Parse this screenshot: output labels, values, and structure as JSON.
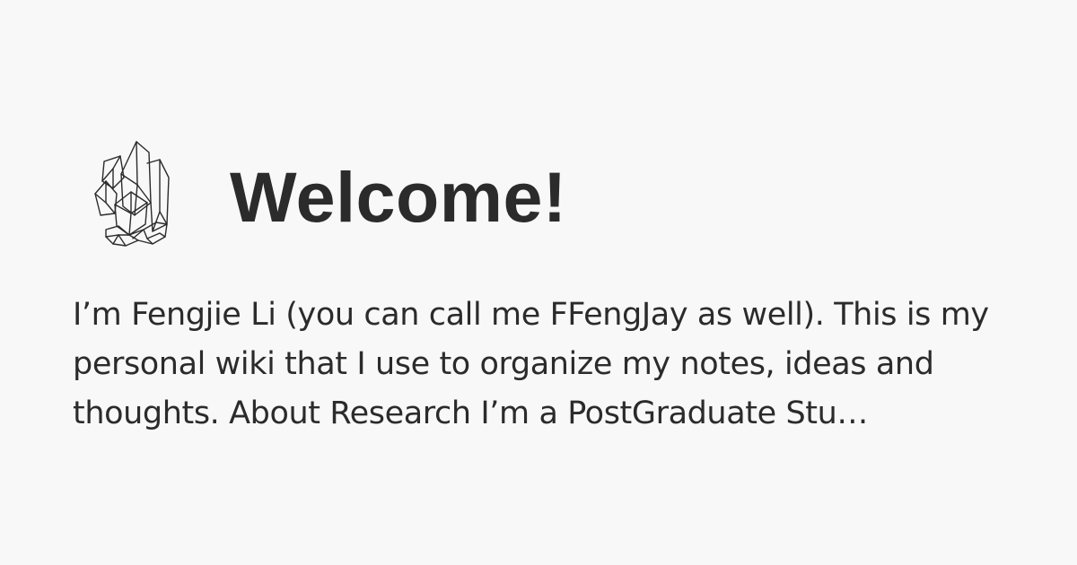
{
  "page": {
    "title": "Welcome!",
    "description": "I’m Fengjie Li (you can call me FFengJay as well). This is my personal wiki that I use to organize my notes, ideas and thoughts. About Research I’m a PostGraduate Stu…",
    "logo_icon": "crystal-cluster-icon",
    "background_color": "#f9f8f9",
    "text_color": "#2b2b2b"
  }
}
